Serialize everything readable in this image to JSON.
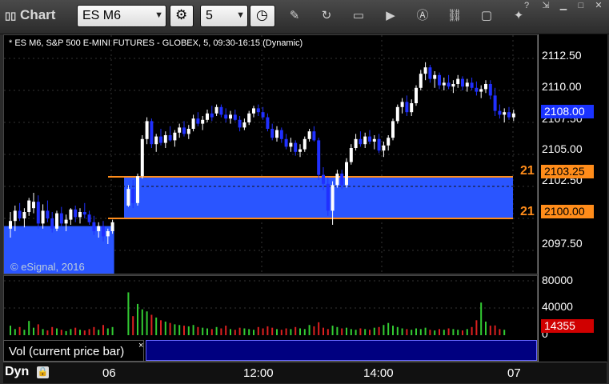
{
  "toolbar": {
    "app_title": "Chart",
    "symbol_value": "ES M6",
    "interval_value": "5"
  },
  "chart": {
    "header": "* ES M6, S&P 500 E-MINI FUTURES - GLOBEX, 5, 09:30-16:15 (Dynamic)",
    "copyright": "© eSignal, 2016",
    "price_ticks": [
      "2112.50",
      "2110.00",
      "2107.50",
      "2105.00",
      "2102.50",
      "2097.50"
    ],
    "current_price": "2108.00",
    "level_upper": "2103.25",
    "level_lower": "2100.00",
    "level_tag_upper": "21",
    "level_tag_lower": "21",
    "colors": {
      "up": "#ffffff",
      "down": "#2030ff",
      "zone": "#2a55ff",
      "level": "#ff8c1a"
    }
  },
  "volume": {
    "ticks": [
      "80000",
      "40000",
      "0"
    ],
    "current": "14355",
    "study_label": "Vol (current price bar)",
    "close_glyph": "×"
  },
  "bottom": {
    "mode": "Dyn",
    "time_labels": [
      "06",
      "12:00",
      "14:00",
      "07"
    ]
  },
  "chart_data": {
    "type": "candlestick",
    "y_range": [
      2096.0,
      2114.0
    ],
    "candles": [
      [
        2099.2,
        2100.5,
        2098.5,
        2099.8
      ],
      [
        2099.8,
        2101.0,
        2099.0,
        2100.6
      ],
      [
        2100.6,
        2101.2,
        2099.8,
        2100.0
      ],
      [
        2100.0,
        2100.8,
        2099.3,
        2100.5
      ],
      [
        2100.5,
        2101.6,
        2100.2,
        2101.4
      ],
      [
        2100.8,
        2102.0,
        2100.4,
        2101.3
      ],
      [
        2101.3,
        2101.8,
        2099.2,
        2099.6
      ],
      [
        2099.6,
        2101.1,
        2099.2,
        2100.6
      ],
      [
        2100.6,
        2101.4,
        2099.7,
        2100.0
      ],
      [
        2100.0,
        2100.5,
        2098.9,
        2099.2
      ],
      [
        2099.2,
        2100.6,
        2099.0,
        2100.4
      ],
      [
        2100.4,
        2100.9,
        2099.4,
        2099.6
      ],
      [
        2099.6,
        2100.3,
        2099.0,
        2099.9
      ],
      [
        2099.9,
        2100.8,
        2099.5,
        2100.7
      ],
      [
        2100.7,
        2101.0,
        2099.7,
        2100.1
      ],
      [
        2100.1,
        2100.8,
        2099.6,
        2100.5
      ],
      [
        2100.5,
        2101.2,
        2100.0,
        2100.3
      ],
      [
        2100.3,
        2100.6,
        2099.5,
        2099.7
      ],
      [
        2099.7,
        2100.2,
        2098.7,
        2099.0
      ],
      [
        2099.0,
        2099.7,
        2098.5,
        2099.4
      ],
      [
        2099.4,
        2099.8,
        2098.2,
        2098.6
      ],
      [
        2098.6,
        2099.2,
        2098.0,
        2099.0
      ],
      [
        2099.0,
        2099.9,
        2098.8,
        2099.7
      ],
      [
        2101.0,
        2102.6,
        2100.9,
        2102.3
      ],
      [
        2102.3,
        2103.0,
        2100.8,
        2101.2
      ],
      [
        2101.2,
        2103.5,
        2101.0,
        2103.3
      ],
      [
        2103.3,
        2106.5,
        2103.1,
        2106.2
      ],
      [
        2106.2,
        2107.9,
        2105.8,
        2107.6
      ],
      [
        2107.6,
        2107.8,
        2105.5,
        2105.8
      ],
      [
        2105.8,
        2106.6,
        2105.2,
        2106.4
      ],
      [
        2106.4,
        2107.0,
        2105.7,
        2105.9
      ],
      [
        2105.9,
        2106.8,
        2105.5,
        2106.5
      ],
      [
        2106.5,
        2107.2,
        2106.0,
        2106.1
      ],
      [
        2106.1,
        2106.9,
        2105.6,
        2106.7
      ],
      [
        2106.7,
        2107.4,
        2106.3,
        2107.1
      ],
      [
        2107.1,
        2107.6,
        2106.4,
        2106.6
      ],
      [
        2106.6,
        2107.3,
        2106.2,
        2107.0
      ],
      [
        2107.0,
        2108.1,
        2106.8,
        2107.8
      ],
      [
        2107.8,
        2108.3,
        2107.2,
        2107.4
      ],
      [
        2107.4,
        2108.0,
        2106.9,
        2107.7
      ],
      [
        2107.7,
        2108.5,
        2107.5,
        2108.2
      ],
      [
        2108.2,
        2108.8,
        2107.6,
        2107.9
      ],
      [
        2108.2,
        2108.9,
        2108.0,
        2108.7
      ],
      [
        2108.7,
        2108.9,
        2107.9,
        2108.1
      ],
      [
        2108.1,
        2108.6,
        2107.5,
        2107.8
      ],
      [
        2107.8,
        2108.4,
        2107.4,
        2108.1
      ],
      [
        2108.1,
        2108.5,
        2107.6,
        2107.7
      ],
      [
        2107.7,
        2108.0,
        2106.8,
        2107.1
      ],
      [
        2107.1,
        2107.8,
        2106.9,
        2107.5
      ],
      [
        2107.5,
        2108.4,
        2107.3,
        2108.2
      ],
      [
        2108.2,
        2108.8,
        2107.9,
        2108.6
      ],
      [
        2108.6,
        2108.9,
        2108.0,
        2108.3
      ],
      [
        2108.3,
        2108.7,
        2107.7,
        2107.9
      ],
      [
        2107.9,
        2108.2,
        2106.8,
        2107.0
      ],
      [
        2107.0,
        2107.4,
        2106.1,
        2106.3
      ],
      [
        2106.3,
        2107.2,
        2106.0,
        2106.9
      ],
      [
        2106.9,
        2107.1,
        2105.9,
        2106.2
      ],
      [
        2106.2,
        2106.6,
        2105.4,
        2105.6
      ],
      [
        2105.6,
        2106.3,
        2105.2,
        2105.9
      ],
      [
        2105.9,
        2106.1,
        2104.9,
        2105.2
      ],
      [
        2105.2,
        2105.8,
        2104.8,
        2105.4
      ],
      [
        2105.4,
        2106.4,
        2105.2,
        2106.2
      ],
      [
        2106.2,
        2107.0,
        2106.0,
        2106.8
      ],
      [
        2106.8,
        2107.2,
        2106.0,
        2106.1
      ],
      [
        2106.1,
        2106.3,
        2103.0,
        2103.4
      ],
      [
        2103.4,
        2104.0,
        2102.2,
        2102.7
      ],
      [
        2102.7,
        2103.2,
        2100.2,
        2100.6
      ],
      [
        2100.6,
        2102.9,
        2099.5,
        2102.6
      ],
      [
        2102.6,
        2103.8,
        2102.4,
        2103.5
      ],
      [
        2103.5,
        2103.8,
        2102.3,
        2102.6
      ],
      [
        2102.6,
        2104.7,
        2102.4,
        2104.4
      ],
      [
        2104.4,
        2105.8,
        2104.2,
        2105.5
      ],
      [
        2105.5,
        2106.6,
        2105.3,
        2106.2
      ],
      [
        2106.2,
        2106.8,
        2105.6,
        2105.8
      ],
      [
        2105.8,
        2106.7,
        2105.5,
        2106.4
      ],
      [
        2106.4,
        2106.9,
        2105.8,
        2106.0
      ],
      [
        2106.0,
        2106.5,
        2105.4,
        2106.2
      ],
      [
        2106.2,
        2106.6,
        2105.1,
        2105.3
      ],
      [
        2105.3,
        2106.0,
        2104.8,
        2105.7
      ],
      [
        2105.7,
        2106.5,
        2105.3,
        2106.3
      ],
      [
        2106.3,
        2107.8,
        2106.1,
        2107.6
      ],
      [
        2107.6,
        2108.9,
        2107.4,
        2108.7
      ],
      [
        2108.7,
        2109.4,
        2108.2,
        2109.1
      ],
      [
        2109.1,
        2109.6,
        2108.0,
        2108.3
      ],
      [
        2108.3,
        2109.3,
        2108.0,
        2109.0
      ],
      [
        2109.0,
        2110.4,
        2108.8,
        2110.2
      ],
      [
        2110.2,
        2111.6,
        2110.0,
        2111.3
      ],
      [
        2111.3,
        2112.2,
        2110.8,
        2111.8
      ],
      [
        2111.8,
        2112.0,
        2110.6,
        2110.9
      ],
      [
        2110.9,
        2111.5,
        2110.2,
        2111.2
      ],
      [
        2111.2,
        2111.4,
        2110.1,
        2110.4
      ],
      [
        2110.4,
        2111.0,
        2110.0,
        2110.6
      ],
      [
        2110.6,
        2111.2,
        2110.1,
        2110.3
      ],
      [
        2110.3,
        2110.8,
        2109.8,
        2110.5
      ],
      [
        2110.5,
        2111.2,
        2110.2,
        2110.9
      ],
      [
        2110.9,
        2111.1,
        2110.0,
        2110.3
      ],
      [
        2110.3,
        2110.9,
        2109.9,
        2110.6
      ],
      [
        2110.6,
        2111.0,
        2110.0,
        2110.2
      ],
      [
        2110.2,
        2110.7,
        2109.6,
        2109.9
      ],
      [
        2109.9,
        2110.4,
        2109.4,
        2110.1
      ],
      [
        2110.1,
        2110.8,
        2109.8,
        2110.5
      ],
      [
        2110.5,
        2110.8,
        2109.3,
        2109.6
      ],
      [
        2109.6,
        2110.2,
        2108.0,
        2108.4
      ],
      [
        2108.4,
        2108.9,
        2107.8,
        2108.1
      ],
      [
        2108.1,
        2108.6,
        2107.5,
        2108.3
      ],
      [
        2108.3,
        2108.7,
        2107.7,
        2107.9
      ],
      [
        2107.9,
        2108.5,
        2107.6,
        2108.2
      ]
    ],
    "volumes": [
      14000,
      9000,
      12000,
      8000,
      21000,
      11000,
      16000,
      9000,
      7000,
      12000,
      10000,
      8000,
      6000,
      9000,
      11000,
      8000,
      7000,
      9000,
      12000,
      8000,
      15000,
      10000,
      12000,
      63000,
      28000,
      46000,
      38000,
      35000,
      30000,
      26000,
      22000,
      20000,
      18000,
      16000,
      15000,
      14000,
      13000,
      15000,
      12000,
      11000,
      10000,
      9000,
      12000,
      10000,
      14000,
      9000,
      8000,
      11000,
      10000,
      9000,
      8000,
      12000,
      10000,
      13000,
      11000,
      9000,
      8000,
      10000,
      9000,
      12000,
      10000,
      9000,
      15000,
      13000,
      19000,
      11000,
      9000,
      14000,
      12000,
      10000,
      11000,
      9000,
      8000,
      10000,
      9000,
      8000,
      11000,
      12000,
      15000,
      18000,
      14000,
      12000,
      10000,
      9000,
      8000,
      10000,
      9000,
      11000,
      8000,
      7000,
      9000,
      8000,
      10000,
      9000,
      8000,
      7000,
      9000,
      12000,
      22000,
      48000,
      20000,
      14000,
      14355,
      9000,
      8000
    ],
    "levels": {
      "upper": 2103.25,
      "lower": 2100.0
    }
  }
}
